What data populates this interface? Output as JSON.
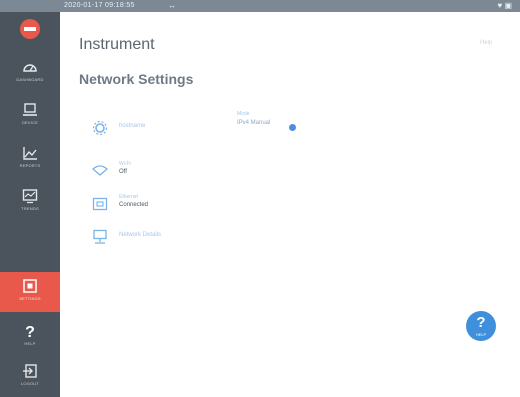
{
  "status_bar": {
    "time": "2020-01-17 09:18:55",
    "arrow": "↔",
    "icons": "♥ ▣"
  },
  "sidebar": {
    "items": [
      {
        "label": "DASHBOARD"
      },
      {
        "label": "DEVICE"
      },
      {
        "label": "REPORTS"
      },
      {
        "label": "TRENDS"
      },
      {
        "label": "SETTINGS"
      },
      {
        "label": "HELP"
      },
      {
        "label": "LOGOUT"
      }
    ]
  },
  "main": {
    "title": "Instrument",
    "help_link": "Help",
    "section_title": "Network Settings",
    "hostname": {
      "label": "hostname"
    },
    "mode": {
      "label": "Mode",
      "value": "IPv4 Manual"
    },
    "wifi": {
      "label": "Wi-Fi",
      "value": "Off"
    },
    "ethernet": {
      "label": "Ethernet",
      "value": "Connected"
    },
    "network_details": {
      "label": "Network Details"
    }
  },
  "fab": {
    "glyph": "?",
    "label": "HELP"
  },
  "colors": {
    "sidebar": "#4b545c",
    "accent": "#e8584b",
    "info": "#3f8fdc"
  }
}
